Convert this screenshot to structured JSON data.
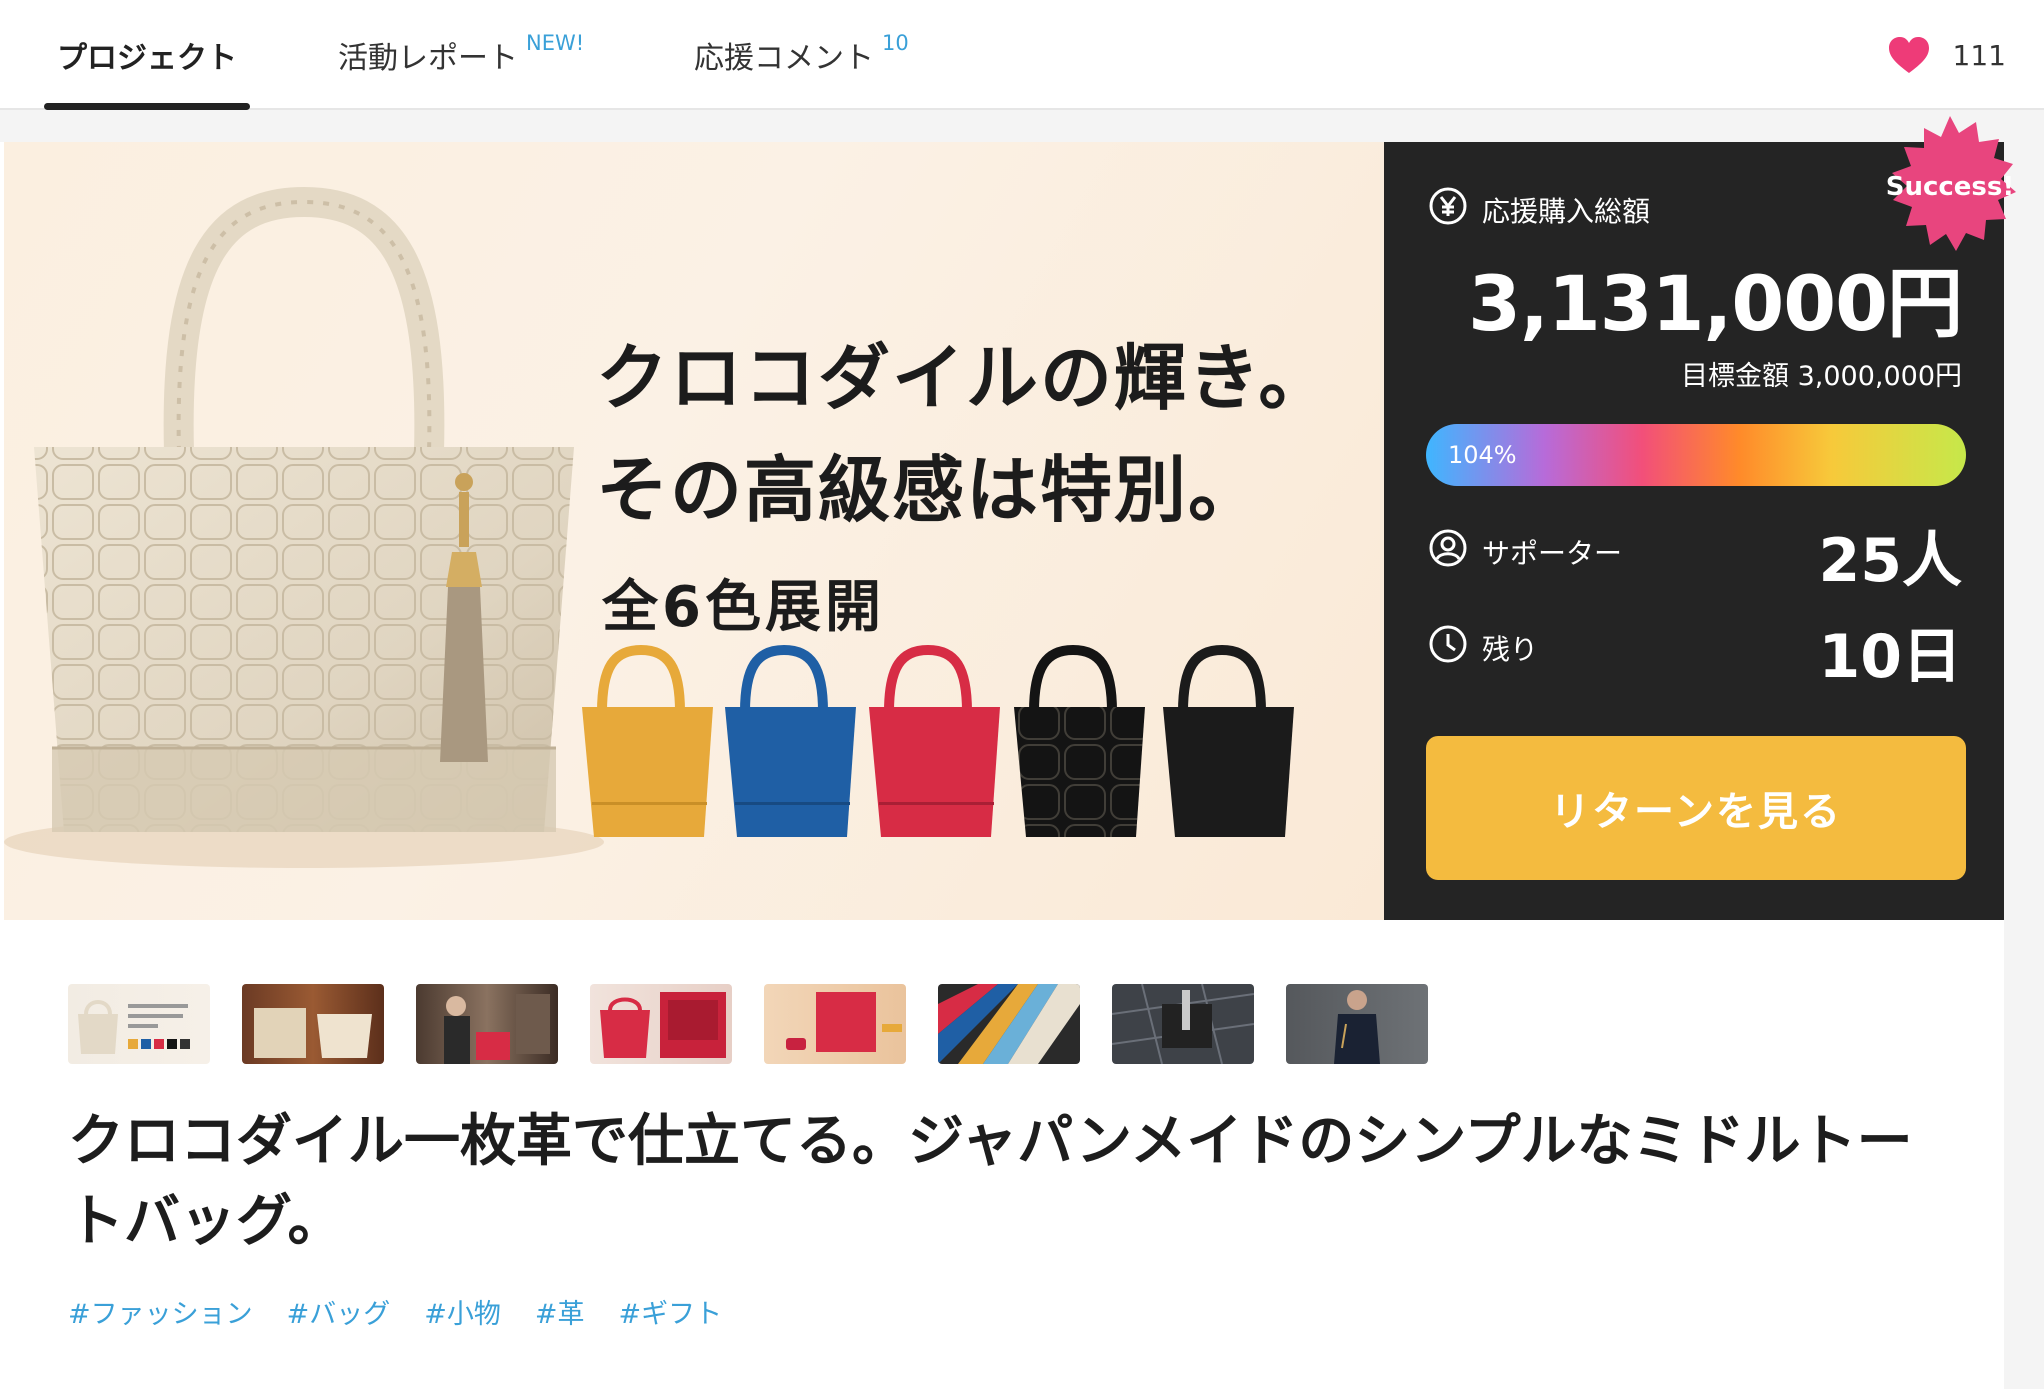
{
  "tabs": {
    "project": "プロジェクト",
    "report": "活動レポート",
    "report_badge": "NEW!",
    "comments": "応援コメント",
    "comments_count": "10"
  },
  "likes": {
    "count": "111",
    "icon": "heart-icon",
    "color": "#ee3b78"
  },
  "hero": {
    "headline_line1": "クロコダイルの輝き。",
    "headline_line2": "その高級感は特別。",
    "subline": "全6色展開",
    "bag_colors": [
      "#e7a93a",
      "#1f5fa5",
      "#d72c45",
      "#141414",
      "#1b1b1b"
    ]
  },
  "stats": {
    "badge": "Success!",
    "total_label": "応援購入総額",
    "total_value": "3,131,000円",
    "goal_text": "目標金額 3,000,000円",
    "progress_text": "104%",
    "progress_value": 1.04,
    "supporters_label": "サポーター",
    "supporters_value": "25人",
    "remaining_label": "残り",
    "remaining_value": "10日",
    "return_button": "リターンを見る",
    "accent_color": "#f4bb3f",
    "badge_color": "#e8457e"
  },
  "title": "クロコダイル一枚革で仕立てる。ジャパンメイドのシンプルなミドルトートバッグ。",
  "tags": [
    "#ファッション",
    "#バッグ",
    "#小物",
    "#革",
    "#ギフト"
  ]
}
